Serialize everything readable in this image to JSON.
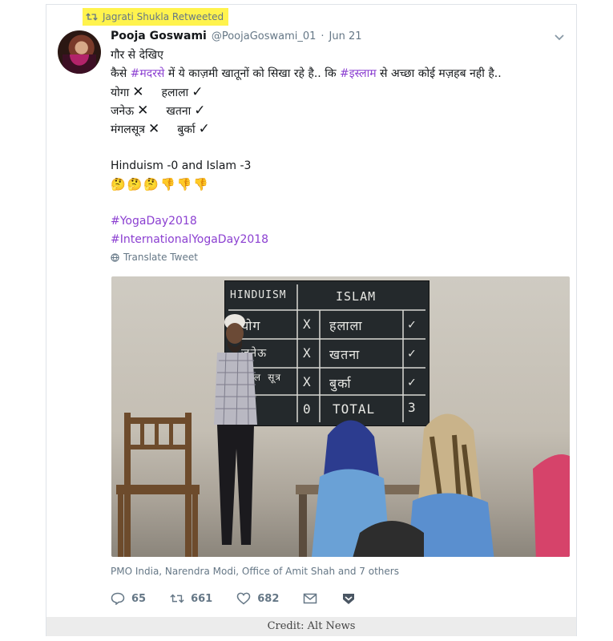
{
  "retweet": {
    "label": "Jagrati Shukla Retweeted",
    "highlight_color": "#fff34d"
  },
  "author": {
    "name": "Pooja Goswami",
    "handle": "@PoojaGoswami_01",
    "separator": "·",
    "date": "Jun 21"
  },
  "tweet": {
    "line1": "गौर से देखिए",
    "line2_a": "कैसे ",
    "line2_tag1": "#मदरसे",
    "line2_b": " में ये काज़मी खातूनों को सिखा रहे है.. कि ",
    "line2_tag2": "#इस्लाम",
    "line2_c": " से अच्छा कोई मज़हब नही है..",
    "pairs": [
      {
        "left": "योगा",
        "x": "✕",
        "right": "हलाला",
        "ok": "✓"
      },
      {
        "left": "जनेऊ",
        "x": "✕",
        "right": "खतना",
        "ok": "✓"
      },
      {
        "left": "मंगलसूत्र",
        "x": "✕",
        "right": "बुर्का",
        "ok": "✓"
      }
    ],
    "score_line": "Hinduism -0 and Islam -3",
    "emojis": "🤔🤔🤔👎👎👎",
    "hashtag1": "#YogaDay2018",
    "hashtag2": "#InternationalYogaDay2018",
    "hashtag_color": "#8b3fd1"
  },
  "translate": {
    "label": "Translate Tweet",
    "icon": "globe-icon"
  },
  "photo": {
    "board": {
      "header_left": "HINDUISM",
      "header_right": "ISLAM",
      "rows": [
        {
          "left": "योग",
          "mid": "X",
          "right": "हलाला",
          "end": "✓"
        },
        {
          "left": "जनेऊ",
          "mid": "X",
          "right": "खतना",
          "end": "✓"
        },
        {
          "left": "मंगल सूत्र",
          "mid": "X",
          "right": "बुर्का",
          "end": "✓"
        }
      ],
      "total_left": "0",
      "total_label": "TOTAL",
      "total_right": "3"
    }
  },
  "mentions": "PMO India, Narendra Modi, Office of Amit Shah and 7 others",
  "actions": {
    "replies": "65",
    "retweets": "661",
    "likes": "682"
  },
  "credit": "Credit: Alt News"
}
